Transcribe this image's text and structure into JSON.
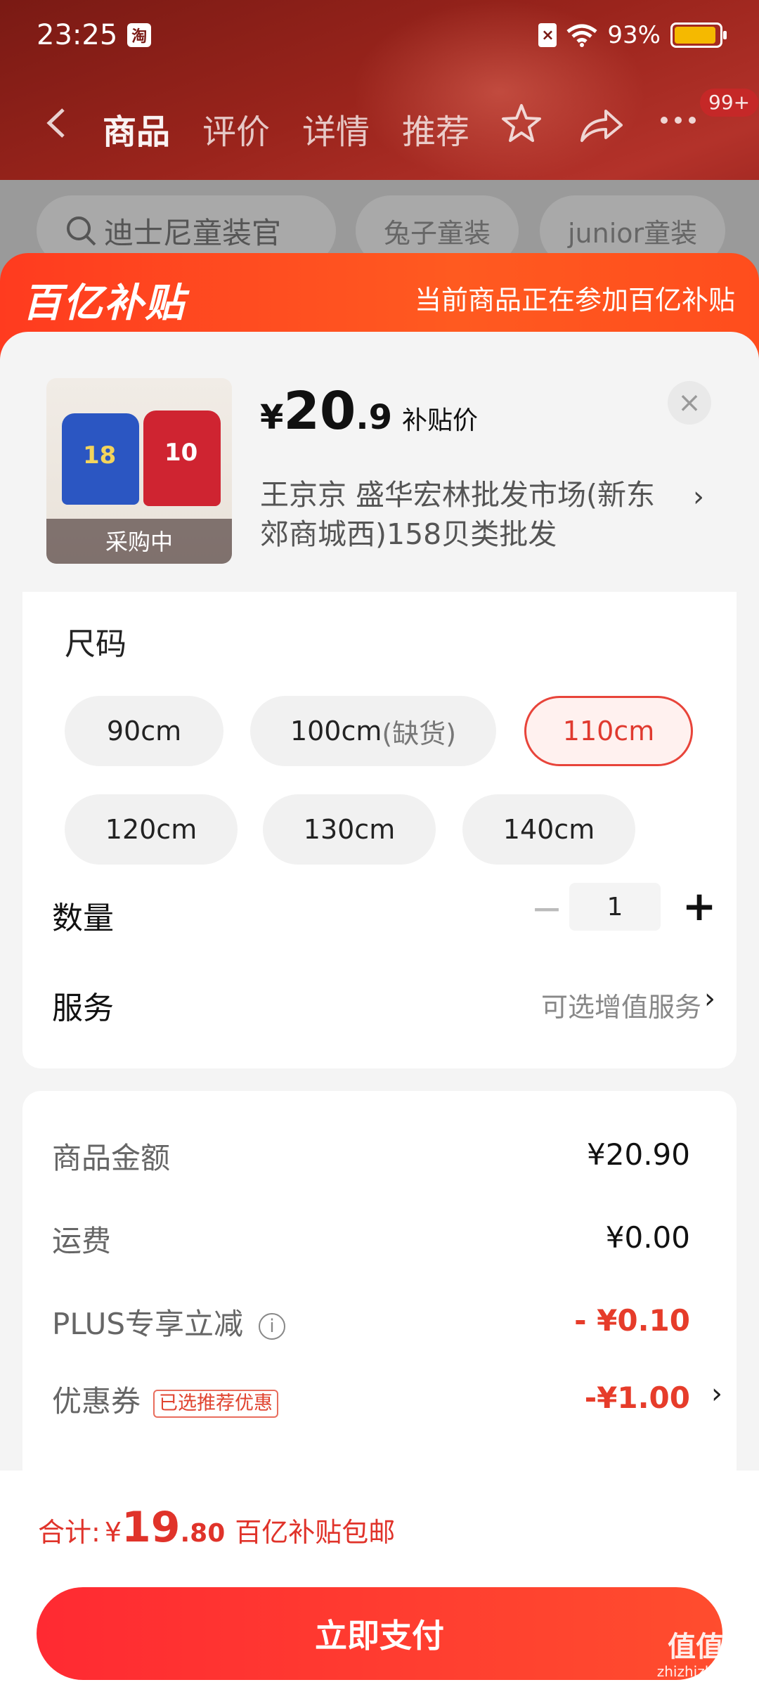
{
  "status_bar": {
    "time": "23:25",
    "app_badge": "淘",
    "battery": "93%",
    "battery_level": 0.93
  },
  "nav": {
    "tabs": [
      "商品",
      "评价",
      "详情",
      "推荐"
    ],
    "badge": "99+"
  },
  "search_chips": {
    "search": "迪士尼童装官",
    "chip1": "兔子童装",
    "chip2": "junior童装"
  },
  "banner": {
    "logo": "百亿补贴",
    "message": "当前商品正在参加百亿补贴"
  },
  "product": {
    "thumb_label": "采购中",
    "price_currency": "¥",
    "price_int": "20",
    "price_dec": ".9",
    "price_tag": "补贴价",
    "seller": "王京京  盛华宏林批发市场(新东郊商城西)158贝类批发"
  },
  "spec": {
    "title": "尺码",
    "sizes": [
      {
        "label": "90cm",
        "note": ""
      },
      {
        "label": "100cm",
        "note": "(缺货)"
      },
      {
        "label": "110cm",
        "note": ""
      },
      {
        "label": "120cm",
        "note": ""
      },
      {
        "label": "130cm",
        "note": ""
      },
      {
        "label": "140cm",
        "note": ""
      }
    ],
    "selected": "110cm"
  },
  "quantity": {
    "label": "数量",
    "minus": "−",
    "value": "1",
    "plus": "+"
  },
  "service": {
    "label": "服务",
    "value": "可选增值服务"
  },
  "summary": {
    "goods_label": "商品金额",
    "goods_value": "¥20.90",
    "shipping_label": "运费",
    "shipping_value": "¥0.00",
    "plus_label": "PLUS专享立减",
    "plus_value": "- ¥0.10",
    "coupon_label": "优惠券",
    "coupon_badge": "已选推荐优惠",
    "coupon_value": "-¥1.00"
  },
  "footer": {
    "total_label": "合计:",
    "total_currency": "¥",
    "total_int": "19",
    "total_dec": ".80",
    "total_note": "百亿补贴包邮",
    "pay_label": "立即支付"
  },
  "watermark": {
    "text": "值值值",
    "sub": "zhizhizhi.com"
  },
  "colors": {
    "accent": "#e63c2a",
    "banner": "#ff4a1f",
    "pay": "#ff3330"
  }
}
